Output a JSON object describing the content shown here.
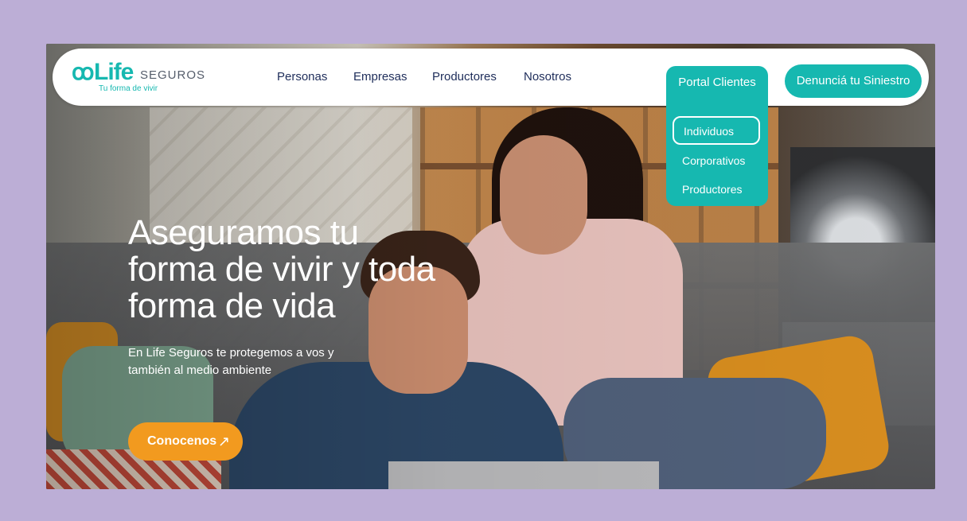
{
  "brand": {
    "logo_mark": "ꝏ",
    "name": "Life",
    "suffix": "SEGUROS",
    "tagline": "Tu forma de vivir",
    "accent_color": "#16b8b0",
    "cta_color": "#f29a1f"
  },
  "nav": {
    "items": [
      {
        "label": "Personas"
      },
      {
        "label": "Empresas"
      },
      {
        "label": "Productores"
      },
      {
        "label": "Nosotros"
      }
    ]
  },
  "portal": {
    "label": "Portal Clientes",
    "options": [
      {
        "label": "Individuos",
        "selected": true
      },
      {
        "label": "Corporativos",
        "selected": false
      },
      {
        "label": "Productores",
        "selected": false
      }
    ]
  },
  "claim_button": {
    "label": "Denunciá tu Siniestro"
  },
  "hero": {
    "title_lines": [
      "Aseguramos tu",
      "forma de vivir y toda",
      "forma de vida"
    ],
    "subtitle": "En Life Seguros te protegemos a vos y también al medio ambiente",
    "cta_label": "Conocenos",
    "cta_icon": "arrow-up-right-icon",
    "cta_glyph": "↗"
  }
}
